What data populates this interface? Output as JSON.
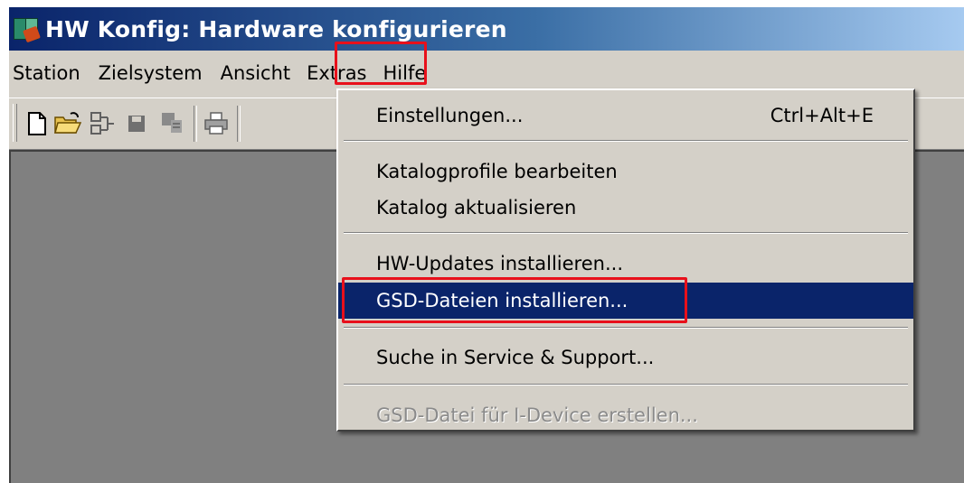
{
  "window": {
    "title": "HW Konfig: Hardware konfigurieren",
    "icon": "hw-config-app-icon"
  },
  "menubar": {
    "items": [
      "Station",
      "Zielsystem",
      "Ansicht",
      "Extras",
      "Hilfe"
    ],
    "open_menu": "Extras"
  },
  "toolbar": {
    "buttons": [
      "new-document-icon",
      "open-folder-icon",
      "network-icon",
      "save-icon",
      "compile-icon",
      "print-icon"
    ]
  },
  "extras_menu": {
    "items": [
      {
        "label": "Einstellungen...",
        "shortcut": "Ctrl+Alt+E"
      },
      {
        "label": "Katalogprofile bearbeiten"
      },
      {
        "label": "Katalog aktualisieren"
      },
      {
        "label": "HW-Updates installieren..."
      },
      {
        "label": "GSD-Dateien installieren...",
        "state": "highlighted"
      },
      {
        "label": "Suche in Service & Support..."
      },
      {
        "label": "GSD-Datei für I-Device erstellen...",
        "state": "disabled"
      }
    ]
  },
  "colors": {
    "title_bar": "#0a246a",
    "menu_background": "#d4d0c8",
    "selection": "#0a246a",
    "annotation": "#e8101b",
    "workspace": "#808080"
  }
}
